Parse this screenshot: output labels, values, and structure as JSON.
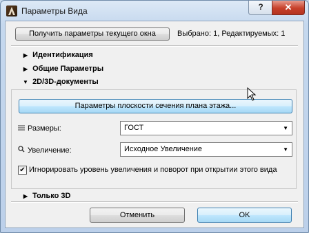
{
  "window": {
    "title": "Параметры Вида",
    "help_label": "?",
    "close_label": "✕"
  },
  "toolbar": {
    "get_params_label": "Получить параметры текущего окна",
    "status_text": "Выбрано: 1, Редактируемых: 1"
  },
  "sections": {
    "identification": {
      "label": "Идентификация",
      "arrow": "▶"
    },
    "general": {
      "label": "Общие Параметры",
      "arrow": "▶"
    },
    "docs2d3d": {
      "label": "2D/3D-документы",
      "arrow": "▼"
    },
    "only3d": {
      "label": "Только 3D",
      "arrow": "▶"
    }
  },
  "docs": {
    "plane_button_label": "Параметры плоскости сечения плана этажа...",
    "dimensions_label": "Размеры:",
    "dimensions_value": "ГОСТ",
    "zoom_label": "Увеличение:",
    "zoom_value": "Исходное Увеличение",
    "ignore_zoom_label": "Игнорировать уровень увеличения и поворот при открытии этого вида",
    "ignore_zoom_checked": true
  },
  "footer": {
    "cancel_label": "Отменить",
    "ok_label": "OK"
  },
  "icons": {
    "app": "archicad-app-icon",
    "dimensions": "dimension-grid-icon",
    "zoom": "magnifier-icon",
    "dropdown": "chevron-down-icon",
    "cursor": "mouse-pointer-icon"
  }
}
